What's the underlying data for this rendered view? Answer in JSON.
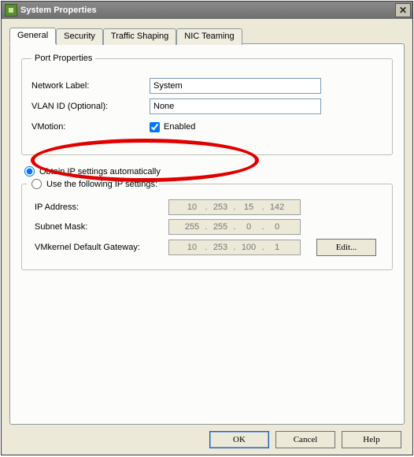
{
  "window": {
    "title": "System Properties"
  },
  "tabs": {
    "general": "General",
    "security": "Security",
    "traffic": "Traffic Shaping",
    "nic": "NIC Teaming"
  },
  "port_properties": {
    "legend": "Port Properties",
    "network_label_lbl": "Network Label:",
    "network_label_val": "System",
    "vlan_lbl": "VLAN ID (Optional):",
    "vlan_val": "None",
    "vmotion_lbl": "VMotion:",
    "vmotion_enable_lbl": "Enabled"
  },
  "ip": {
    "obtain_lbl": "Obtain IP settings automatically",
    "use_lbl": "Use the following IP settings:",
    "ip_addr_lbl": "IP Address:",
    "ip_addr": {
      "o1": "10",
      "o2": "253",
      "o3": "15",
      "o4": "142"
    },
    "subnet_lbl": "Subnet Mask:",
    "subnet": {
      "o1": "255",
      "o2": "255",
      "o3": "0",
      "o4": "0"
    },
    "gw_lbl": "VMkernel Default Gateway:",
    "gw": {
      "o1": "10",
      "o2": "253",
      "o3": "100",
      "o4": "1"
    },
    "edit_btn": "Edit..."
  },
  "buttons": {
    "ok": "OK",
    "cancel": "Cancel",
    "help": "Help"
  },
  "glyph": {
    "dot": "."
  }
}
